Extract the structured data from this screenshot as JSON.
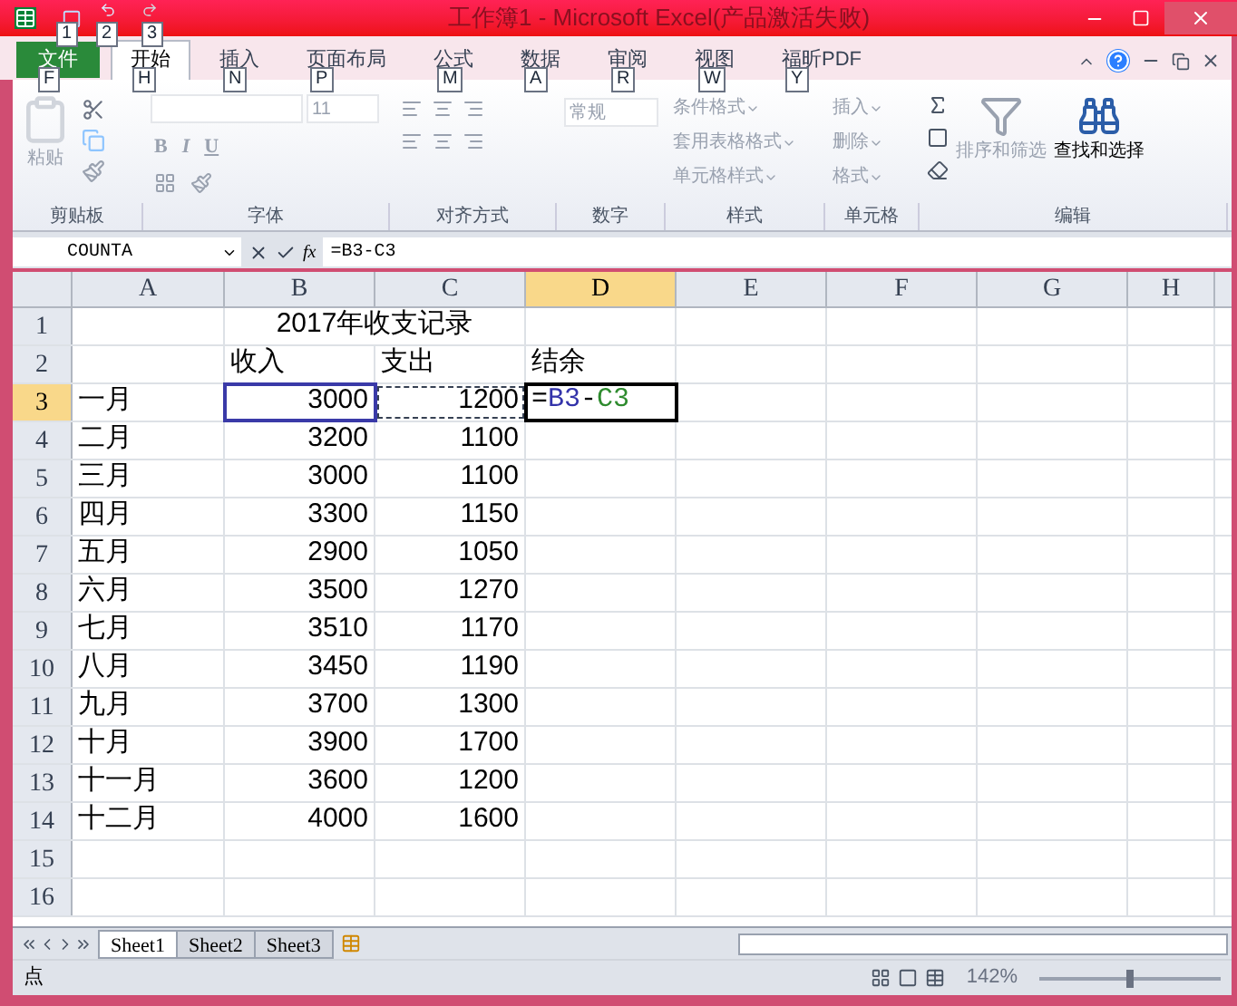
{
  "window": {
    "title": "工作簿1 - Microsoft Excel(产品激活失败)"
  },
  "quick_access_keytips": [
    "1",
    "2",
    "3"
  ],
  "tabs": [
    {
      "label": "文件",
      "keytip": "F",
      "selected": false,
      "kind": "file"
    },
    {
      "label": "开始",
      "keytip": "H",
      "selected": true,
      "kind": "tab"
    },
    {
      "label": "插入",
      "keytip": "N",
      "selected": false,
      "kind": "tab"
    },
    {
      "label": "页面布局",
      "keytip": "P",
      "selected": false,
      "kind": "tab"
    },
    {
      "label": "公式",
      "keytip": "M",
      "selected": false,
      "kind": "tab"
    },
    {
      "label": "数据",
      "keytip": "A",
      "selected": false,
      "kind": "tab"
    },
    {
      "label": "审阅",
      "keytip": "R",
      "selected": false,
      "kind": "tab"
    },
    {
      "label": "视图",
      "keytip": "W",
      "selected": false,
      "kind": "tab"
    },
    {
      "label": "福昕PDF",
      "keytip": "Y",
      "selected": false,
      "kind": "tab"
    }
  ],
  "ribbon": {
    "paste": "粘贴",
    "font_size": "11",
    "font_buttons": [
      "B",
      "I",
      "U"
    ],
    "number_format": "常规",
    "styles": [
      {
        "label": "条件格式",
        "disabled": true
      },
      {
        "label": "套用表格格式",
        "disabled": true
      },
      {
        "label": "单元格样式",
        "disabled": true
      }
    ],
    "cells": [
      {
        "label": "插入",
        "disabled": true
      },
      {
        "label": "删除",
        "disabled": true
      },
      {
        "label": "格式",
        "disabled": true
      }
    ],
    "editing": [
      {
        "label": "排序和筛选",
        "disabled": true
      },
      {
        "label": "查找和选择",
        "disabled": false
      }
    ],
    "groups": [
      "剪贴板",
      "字体",
      "对齐方式",
      "数字",
      "样式",
      "单元格",
      "编辑"
    ]
  },
  "formula_bar": {
    "name_box": "COUNTA",
    "fx": "fx",
    "formula": "=B3-C3"
  },
  "columns": [
    {
      "label": "A",
      "selected": false
    },
    {
      "label": "B",
      "selected": false
    },
    {
      "label": "C",
      "selected": false
    },
    {
      "label": "D",
      "selected": true
    },
    {
      "label": "E",
      "selected": false
    },
    {
      "label": "F",
      "selected": false
    },
    {
      "label": "G",
      "selected": false
    },
    {
      "label": "H",
      "selected": false
    }
  ],
  "rows": [
    {
      "header": "1",
      "kind": "title",
      "selected": false,
      "title": "2017年收支记录"
    },
    {
      "header": "2",
      "kind": "labels",
      "selected": false,
      "cells": [
        "",
        "收入",
        "支出",
        "结余"
      ]
    },
    {
      "header": "3",
      "kind": "edit",
      "selected": true,
      "cells": [
        "一月",
        "3000",
        "1200"
      ],
      "formula": [
        {
          "text": "=",
          "color": "#000000"
        },
        {
          "text": "B3",
          "color": "#3333aa"
        },
        {
          "text": "-",
          "color": "#000000"
        },
        {
          "text": "C3",
          "color": "#2e8b2e"
        }
      ]
    },
    {
      "header": "4",
      "kind": "data",
      "selected": false,
      "cells": [
        "二月",
        "3200",
        "1100"
      ]
    },
    {
      "header": "5",
      "kind": "data",
      "selected": false,
      "cells": [
        "三月",
        "3000",
        "1100"
      ]
    },
    {
      "header": "6",
      "kind": "data",
      "selected": false,
      "cells": [
        "四月",
        "3300",
        "1150"
      ]
    },
    {
      "header": "7",
      "kind": "data",
      "selected": false,
      "cells": [
        "五月",
        "2900",
        "1050"
      ]
    },
    {
      "header": "8",
      "kind": "data",
      "selected": false,
      "cells": [
        "六月",
        "3500",
        "1270"
      ]
    },
    {
      "header": "9",
      "kind": "data",
      "selected": false,
      "cells": [
        "七月",
        "3510",
        "1170"
      ]
    },
    {
      "header": "10",
      "kind": "data",
      "selected": false,
      "cells": [
        "八月",
        "3450",
        "1190"
      ]
    },
    {
      "header": "11",
      "kind": "data",
      "selected": false,
      "cells": [
        "九月",
        "3700",
        "1300"
      ]
    },
    {
      "header": "12",
      "kind": "data",
      "selected": false,
      "cells": [
        "十月",
        "3900",
        "1700"
      ]
    },
    {
      "header": "13",
      "kind": "data",
      "selected": false,
      "cells": [
        "十一月",
        "3600",
        "1200"
      ]
    },
    {
      "header": "14",
      "kind": "data",
      "selected": false,
      "cells": [
        "十二月",
        "4000",
        "1600"
      ]
    },
    {
      "header": "15",
      "kind": "data",
      "selected": false,
      "cells": []
    },
    {
      "header": "16",
      "kind": "data",
      "selected": false,
      "cells": []
    }
  ],
  "sheets": [
    {
      "label": "Sheet1",
      "selected": true
    },
    {
      "label": "Sheet2",
      "selected": false
    },
    {
      "label": "Sheet3",
      "selected": false
    }
  ],
  "status_bar": {
    "mode": "点",
    "zoom": "142%",
    "zoom_slider": {
      "level": 0.5
    }
  }
}
